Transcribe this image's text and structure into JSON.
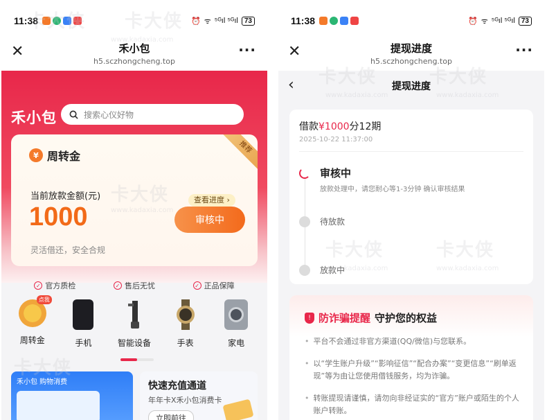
{
  "status_bar": {
    "time": "11:38",
    "battery": "73",
    "network": "⁵ᴳıl ⁵ᴳıl"
  },
  "left": {
    "browser": {
      "title": "禾小包",
      "url": "h5.sczhongcheng.top",
      "more": "···"
    },
    "brand": "禾小包",
    "search": {
      "placeholder": "搜索心仪好物"
    },
    "loan_card": {
      "title": "周转金",
      "ribbon": "推荐",
      "amount_label": "当前放款金额(元)",
      "amount": "1000",
      "progress_tag": "查看进度 ›",
      "button": "审核中",
      "note": "灵活借还，安全合规"
    },
    "guarantees": [
      "官方质检",
      "售后无忧",
      "正品保障"
    ],
    "categories": [
      {
        "label": "周转金",
        "badge": "点我",
        "icon": "coin-bag-icon"
      },
      {
        "label": "手机",
        "icon": "phone-icon"
      },
      {
        "label": "智能设备",
        "icon": "device-icon"
      },
      {
        "label": "手表",
        "icon": "watch-icon"
      },
      {
        "label": "家电",
        "icon": "washer-icon"
      }
    ],
    "promo_left": {
      "tag": "禾小包 购物消费"
    },
    "promo_right": {
      "title": "快速充值通道",
      "subtitle": "年年卡X禾小包消费卡",
      "button": "立即前往"
    }
  },
  "right": {
    "browser": {
      "title": "提现进度",
      "url": "h5.sczhongcheng.top",
      "more": "···"
    },
    "nav_title": "提现进度",
    "loan_head": {
      "prefix": "借款",
      "amount": "¥1000",
      "suffix": "分12期"
    },
    "loan_time": "2025-10-22 11:37:00",
    "steps": [
      {
        "title": "审核中",
        "desc": "放款处理中，请您耐心等1-3分钟 确认审核结果"
      },
      {
        "title": "待放款"
      },
      {
        "title": "放款中"
      }
    ],
    "fraud": {
      "title_red": "防诈骗提醒",
      "title_black": "守护您的权益",
      "items": [
        "平台不会通过非官方渠道(QQ/微信)与您联系。",
        "以“学生账户升级”“影响征信”“配合办案”“变更信息”“刷单返现”等为由让您使用借钱服务，均为诈骗。",
        "转账提现请谨慎，请勿向非经证实的“官方”账户或陌生的个人账户转账。"
      ]
    }
  },
  "watermark": {
    "text": "卡大侠",
    "url": "www.kadaxia.com"
  },
  "colors": {
    "brand_red": "#e8274a",
    "orange": "#f36a1c"
  }
}
